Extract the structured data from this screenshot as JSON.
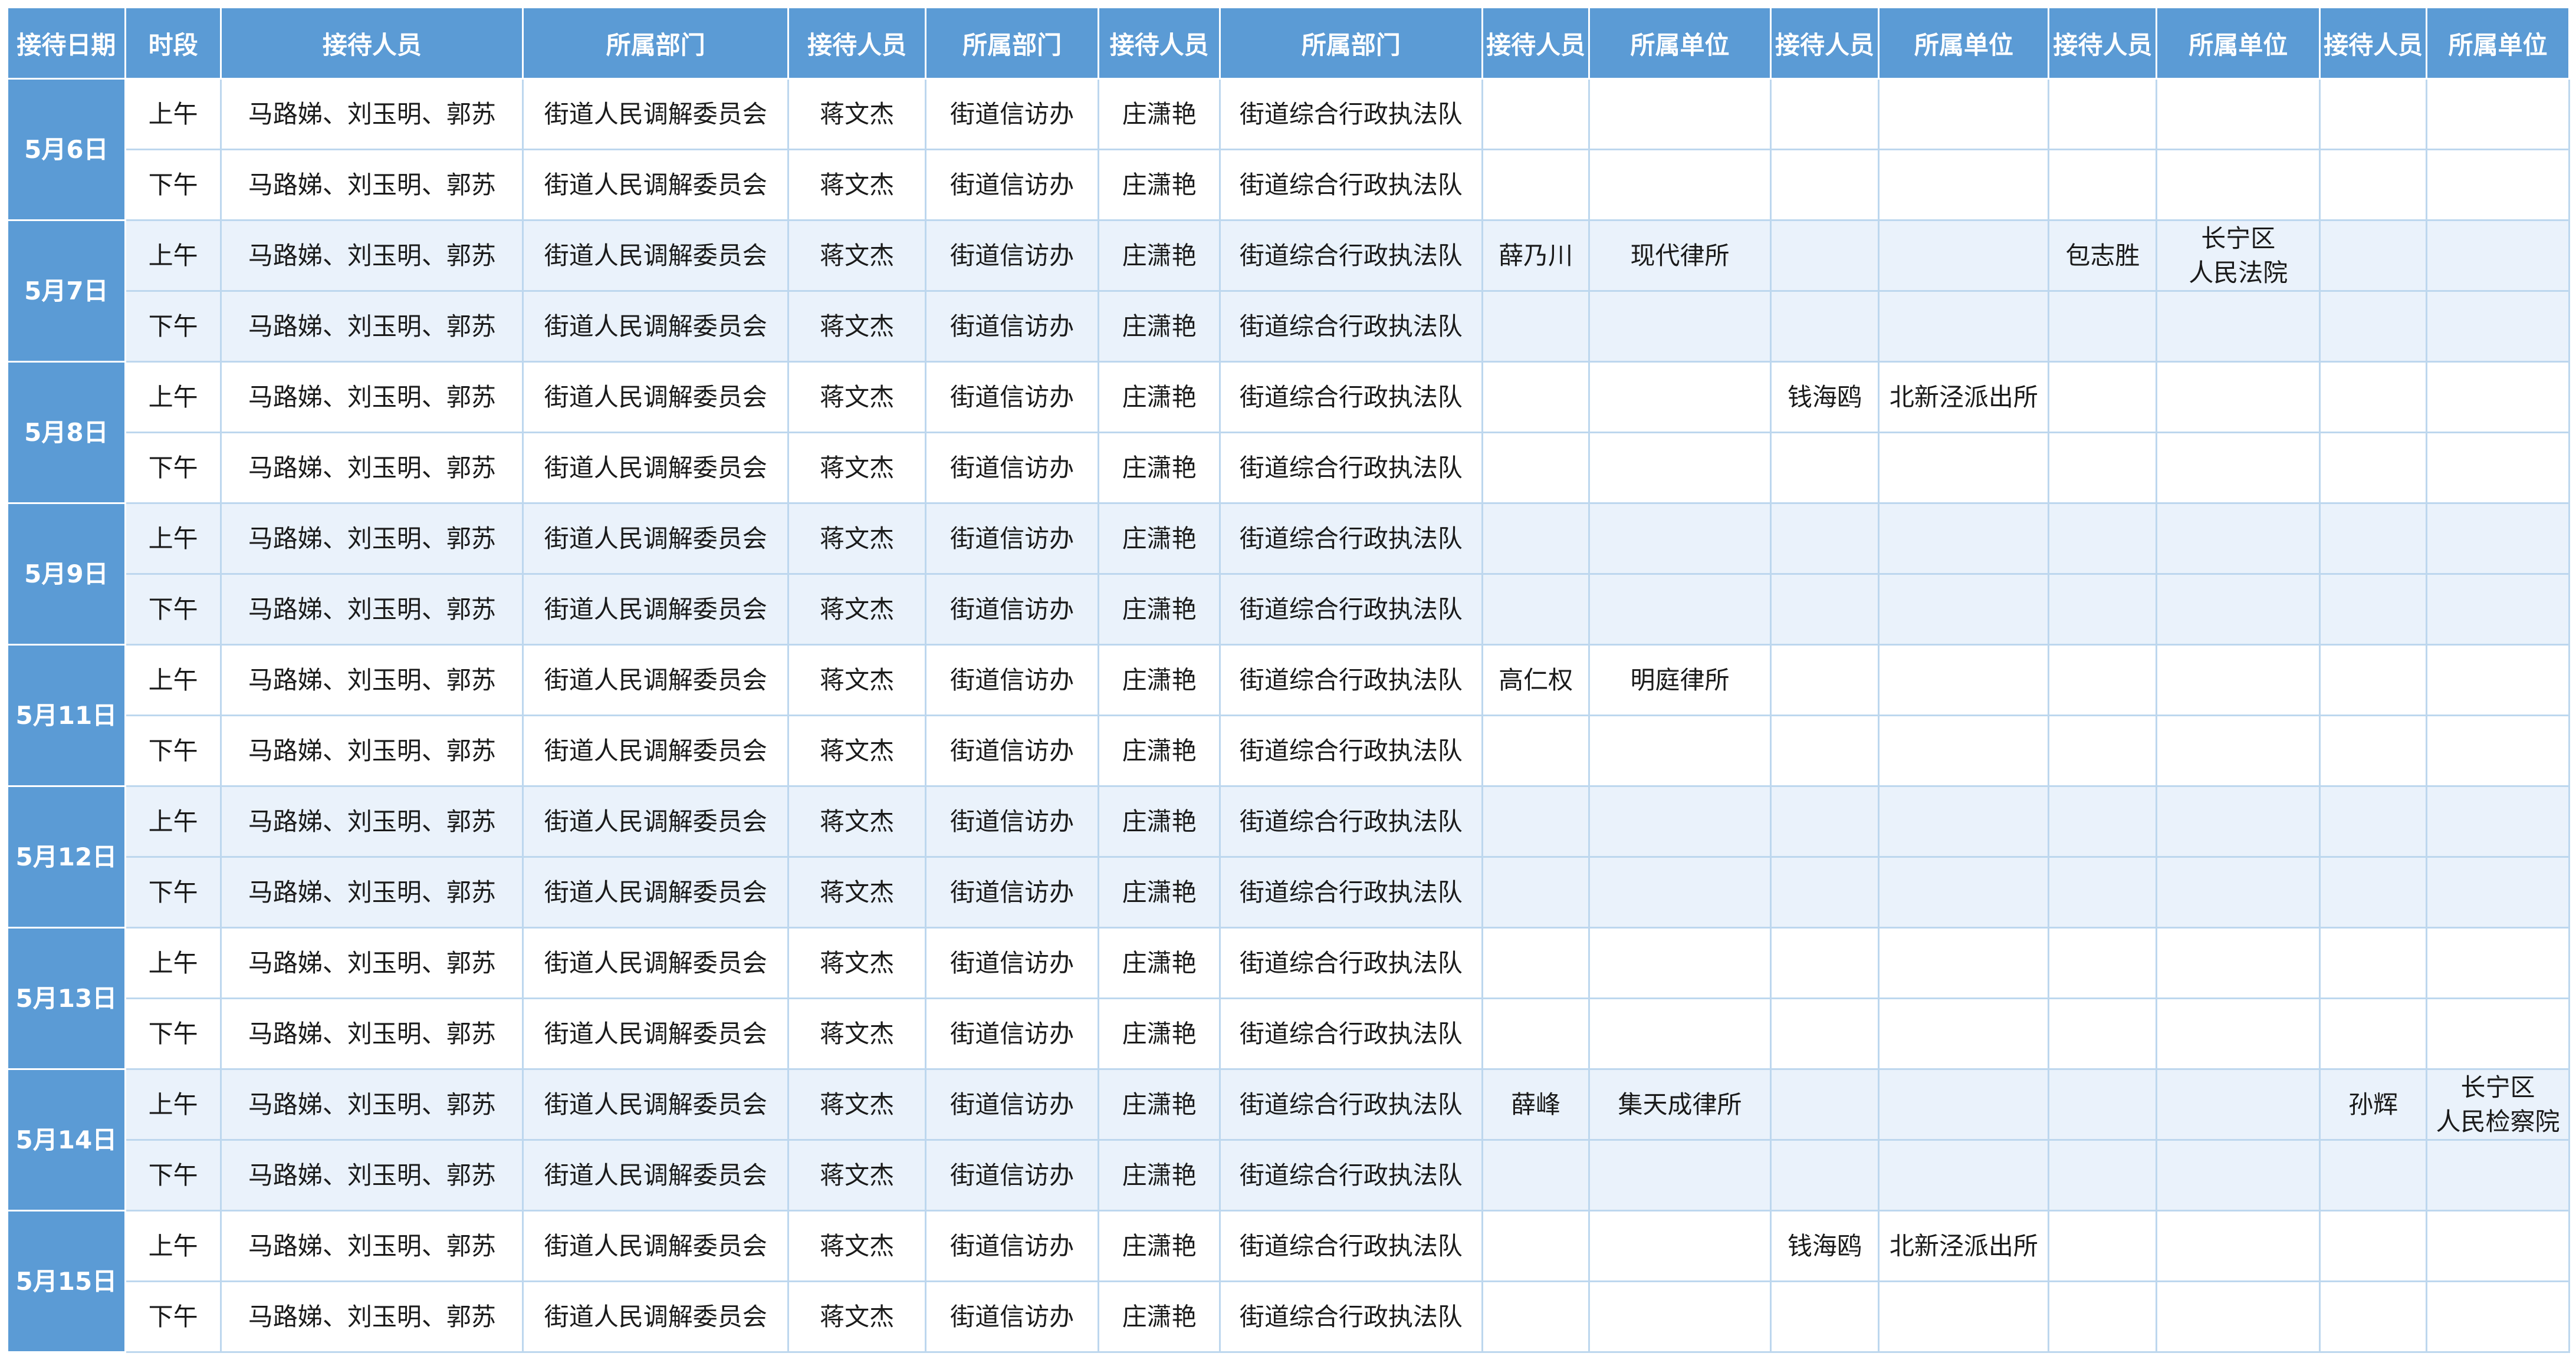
{
  "headers": [
    "接待日期",
    "时段",
    "接待人员",
    "所属部门",
    "接待人员",
    "所属部门",
    "接待人员",
    "所属部门",
    "接待人员",
    "所属单位",
    "接待人员",
    "所属单位",
    "接待人员",
    "所属单位",
    "接待人员",
    "所属单位"
  ],
  "days": [
    {
      "date": "5月6日",
      "rows": [
        {
          "period": "上午",
          "cells": [
            "马路娣、刘玉明、郭苏",
            "街道人民调解委员会",
            "蒋文杰",
            "街道信访办",
            "庄潇艳",
            "街道综合行政执法队",
            "",
            "",
            "",
            "",
            "",
            "",
            "",
            ""
          ]
        },
        {
          "period": "下午",
          "cells": [
            "马路娣、刘玉明、郭苏",
            "街道人民调解委员会",
            "蒋文杰",
            "街道信访办",
            "庄潇艳",
            "街道综合行政执法队",
            "",
            "",
            "",
            "",
            "",
            "",
            "",
            ""
          ]
        }
      ]
    },
    {
      "date": "5月7日",
      "rows": [
        {
          "period": "上午",
          "cells": [
            "马路娣、刘玉明、郭苏",
            "街道人民调解委员会",
            "蒋文杰",
            "街道信访办",
            "庄潇艳",
            "街道综合行政执法队",
            "薛乃川",
            "现代律所",
            "",
            "",
            "包志胜",
            [
              "长宁区",
              "人民法院"
            ],
            "",
            ""
          ]
        },
        {
          "period": "下午",
          "cells": [
            "马路娣、刘玉明、郭苏",
            "街道人民调解委员会",
            "蒋文杰",
            "街道信访办",
            "庄潇艳",
            "街道综合行政执法队",
            "",
            "",
            "",
            "",
            "",
            "",
            "",
            ""
          ]
        }
      ]
    },
    {
      "date": "5月8日",
      "rows": [
        {
          "period": "上午",
          "cells": [
            "马路娣、刘玉明、郭苏",
            "街道人民调解委员会",
            "蒋文杰",
            "街道信访办",
            "庄潇艳",
            "街道综合行政执法队",
            "",
            "",
            "钱海鸥",
            "北新泾派出所",
            "",
            "",
            "",
            ""
          ]
        },
        {
          "period": "下午",
          "cells": [
            "马路娣、刘玉明、郭苏",
            "街道人民调解委员会",
            "蒋文杰",
            "街道信访办",
            "庄潇艳",
            "街道综合行政执法队",
            "",
            "",
            "",
            "",
            "",
            "",
            "",
            ""
          ]
        }
      ]
    },
    {
      "date": "5月9日",
      "rows": [
        {
          "period": "上午",
          "cells": [
            "马路娣、刘玉明、郭苏",
            "街道人民调解委员会",
            "蒋文杰",
            "街道信访办",
            "庄潇艳",
            "街道综合行政执法队",
            "",
            "",
            "",
            "",
            "",
            "",
            "",
            ""
          ]
        },
        {
          "period": "下午",
          "cells": [
            "马路娣、刘玉明、郭苏",
            "街道人民调解委员会",
            "蒋文杰",
            "街道信访办",
            "庄潇艳",
            "街道综合行政执法队",
            "",
            "",
            "",
            "",
            "",
            "",
            "",
            ""
          ]
        }
      ]
    },
    {
      "date": "5月11日",
      "rows": [
        {
          "period": "上午",
          "cells": [
            "马路娣、刘玉明、郭苏",
            "街道人民调解委员会",
            "蒋文杰",
            "街道信访办",
            "庄潇艳",
            "街道综合行政执法队",
            "高仁权",
            "明庭律所",
            "",
            "",
            "",
            "",
            "",
            ""
          ]
        },
        {
          "period": "下午",
          "cells": [
            "马路娣、刘玉明、郭苏",
            "街道人民调解委员会",
            "蒋文杰",
            "街道信访办",
            "庄潇艳",
            "街道综合行政执法队",
            "",
            "",
            "",
            "",
            "",
            "",
            "",
            ""
          ]
        }
      ]
    },
    {
      "date": "5月12日",
      "rows": [
        {
          "period": "上午",
          "cells": [
            "马路娣、刘玉明、郭苏",
            "街道人民调解委员会",
            "蒋文杰",
            "街道信访办",
            "庄潇艳",
            "街道综合行政执法队",
            "",
            "",
            "",
            "",
            "",
            "",
            "",
            ""
          ]
        },
        {
          "period": "下午",
          "cells": [
            "马路娣、刘玉明、郭苏",
            "街道人民调解委员会",
            "蒋文杰",
            "街道信访办",
            "庄潇艳",
            "街道综合行政执法队",
            "",
            "",
            "",
            "",
            "",
            "",
            "",
            ""
          ]
        }
      ]
    },
    {
      "date": "5月13日",
      "rows": [
        {
          "period": "上午",
          "cells": [
            "马路娣、刘玉明、郭苏",
            "街道人民调解委员会",
            "蒋文杰",
            "街道信访办",
            "庄潇艳",
            "街道综合行政执法队",
            "",
            "",
            "",
            "",
            "",
            "",
            "",
            ""
          ]
        },
        {
          "period": "下午",
          "cells": [
            "马路娣、刘玉明、郭苏",
            "街道人民调解委员会",
            "蒋文杰",
            "街道信访办",
            "庄潇艳",
            "街道综合行政执法队",
            "",
            "",
            "",
            "",
            "",
            "",
            "",
            ""
          ]
        }
      ]
    },
    {
      "date": "5月14日",
      "rows": [
        {
          "period": "上午",
          "cells": [
            "马路娣、刘玉明、郭苏",
            "街道人民调解委员会",
            "蒋文杰",
            "街道信访办",
            "庄潇艳",
            "街道综合行政执法队",
            "薛峰",
            "集天成律所",
            "",
            "",
            "",
            "",
            "孙辉",
            [
              "长宁区",
              "人民检察院"
            ]
          ]
        },
        {
          "period": "下午",
          "cells": [
            "马路娣、刘玉明、郭苏",
            "街道人民调解委员会",
            "蒋文杰",
            "街道信访办",
            "庄潇艳",
            "街道综合行政执法队",
            "",
            "",
            "",
            "",
            "",
            "",
            "",
            ""
          ]
        }
      ]
    },
    {
      "date": "5月15日",
      "rows": [
        {
          "period": "上午",
          "cells": [
            "马路娣、刘玉明、郭苏",
            "街道人民调解委员会",
            "蒋文杰",
            "街道信访办",
            "庄潇艳",
            "街道综合行政执法队",
            "",
            "",
            "钱海鸥",
            "北新泾派出所",
            "",
            "",
            "",
            ""
          ]
        },
        {
          "period": "下午",
          "cells": [
            "马路娣、刘玉明、郭苏",
            "街道人民调解委员会",
            "蒋文杰",
            "街道信访办",
            "庄潇艳",
            "街道综合行政执法队",
            "",
            "",
            "",
            "",
            "",
            "",
            "",
            ""
          ]
        }
      ]
    }
  ],
  "colors": {
    "header_bg": "#5b9bd5",
    "header_text": "#ffffff",
    "alt_row_bg": "#eaf2fb",
    "grid_line": "#bdd7ee"
  }
}
